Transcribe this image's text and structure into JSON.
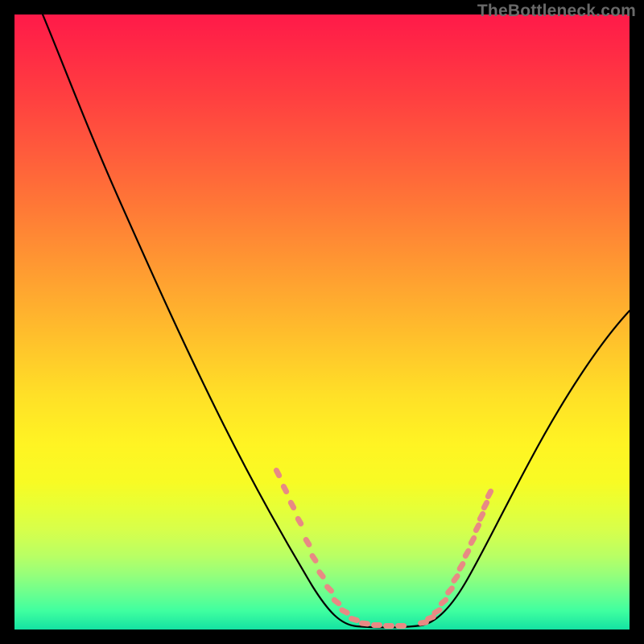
{
  "watermark": "TheBottleneck.com",
  "colors": {
    "background": "#000000",
    "gradient_top": "#ff1a49",
    "gradient_bottom": "#14e2a2",
    "curve": "#000000",
    "dots": "#e88a84"
  },
  "chart_data": {
    "type": "line",
    "title": "",
    "xlabel": "",
    "ylabel": "",
    "xlim": [
      0,
      100
    ],
    "ylim": [
      0,
      100
    ],
    "legend": "none",
    "grid": false,
    "series": [
      {
        "name": "bottleneck-curve",
        "x": [
          0,
          5,
          10,
          15,
          20,
          25,
          30,
          35,
          40,
          45,
          48,
          50,
          53,
          56,
          60,
          64,
          68,
          72,
          76,
          80,
          85,
          90,
          95,
          100
        ],
        "y": [
          100,
          97,
          92,
          85,
          76,
          66,
          56,
          46,
          35,
          22,
          12,
          5,
          1,
          0,
          0,
          0,
          1,
          4,
          10,
          18,
          28,
          38,
          46,
          52
        ]
      }
    ],
    "markers": [
      {
        "name": "left-cluster",
        "x": [
          42.5,
          43.5,
          44.5,
          45.5,
          47.0,
          48.0,
          49.5,
          51.0,
          52.0,
          53.0,
          54.5,
          56.0,
          58.0,
          60.0,
          62.0
        ],
        "y": [
          26,
          23,
          20,
          17,
          13,
          10,
          7,
          5,
          3,
          2,
          1,
          0,
          0,
          0,
          0
        ]
      },
      {
        "name": "right-cluster",
        "x": [
          66.0,
          67.0,
          68.0,
          69.0,
          70.0,
          71.0,
          72.0,
          73.0,
          74.0,
          75.0,
          75.5,
          76.0,
          76.5
        ],
        "y": [
          1,
          2,
          3,
          5,
          7,
          9,
          11,
          13,
          15,
          17,
          19,
          21,
          23
        ]
      }
    ],
    "annotations": []
  }
}
